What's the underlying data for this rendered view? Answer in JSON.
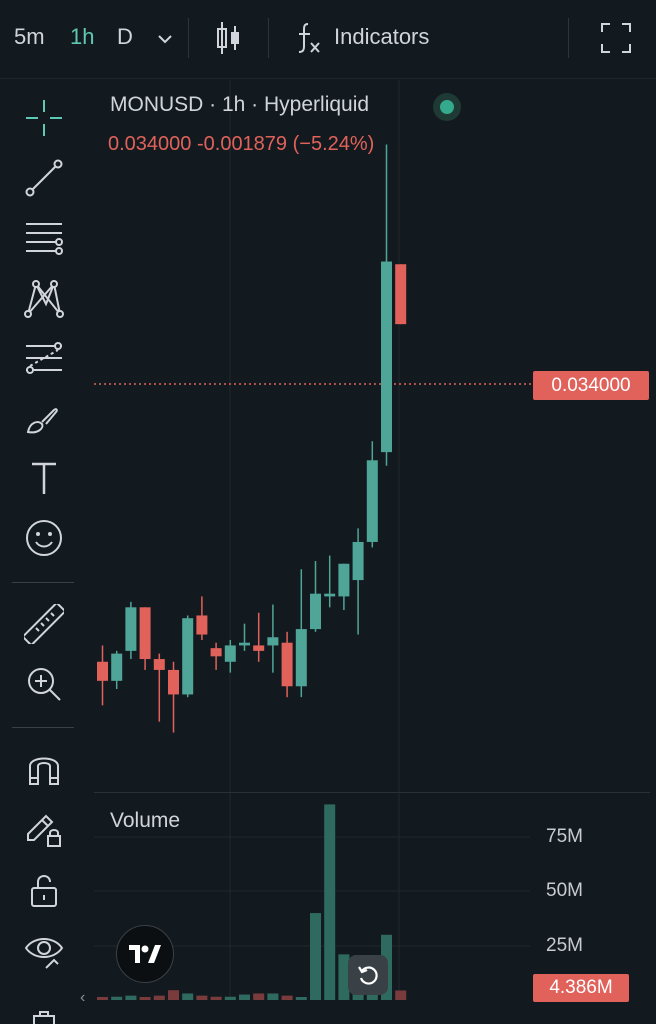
{
  "topbar": {
    "timeframes": [
      {
        "label": "5m",
        "active": false
      },
      {
        "label": "1h",
        "active": true
      },
      {
        "label": "D",
        "active": false
      }
    ],
    "indicators_label": "Indicators",
    "icons": [
      "chevron-down-icon",
      "candles-icon",
      "function-icon",
      "fullscreen-icon"
    ]
  },
  "toolbar": {
    "tools": [
      "crosshair-icon",
      "trend-line-icon",
      "horizontal-lines-icon",
      "pattern-icon",
      "fib-icon",
      "brush-icon",
      "text-icon",
      "emoji-icon",
      "ruler-icon",
      "zoom-in-icon",
      "magnet-icon",
      "lock-drawing-icon",
      "lock-icon",
      "eye-icon"
    ]
  },
  "legend": {
    "symbol": "MONUSD · 1h · Hyperliquid",
    "values": "0.034000  -0.001879 (−5.24%)",
    "price_tag": "0.034000"
  },
  "volume": {
    "label": "Volume",
    "axis": [
      "75M",
      "50M",
      "25M"
    ],
    "tag": "4.386M"
  },
  "colors": {
    "up": "#4fa698",
    "down": "#e0625a",
    "background": "#131a1f"
  },
  "chart_data": {
    "type": "candlestick",
    "title": "MONUSD · 1h · Hyperliquid",
    "candles": [
      {
        "o": 0.0216,
        "h": 0.0222,
        "l": 0.02,
        "c": 0.0209
      },
      {
        "o": 0.0209,
        "h": 0.022,
        "l": 0.0206,
        "c": 0.0219
      },
      {
        "o": 0.022,
        "h": 0.0238,
        "l": 0.0217,
        "c": 0.0236
      },
      {
        "o": 0.0236,
        "h": 0.0236,
        "l": 0.0213,
        "c": 0.0217
      },
      {
        "o": 0.0217,
        "h": 0.0219,
        "l": 0.0194,
        "c": 0.0213
      },
      {
        "o": 0.0213,
        "h": 0.0216,
        "l": 0.019,
        "c": 0.0204
      },
      {
        "o": 0.0204,
        "h": 0.0233,
        "l": 0.0203,
        "c": 0.0232
      },
      {
        "o": 0.0233,
        "h": 0.024,
        "l": 0.0224,
        "c": 0.0226
      },
      {
        "o": 0.0221,
        "h": 0.0223,
        "l": 0.0213,
        "c": 0.0218
      },
      {
        "o": 0.0216,
        "h": 0.0224,
        "l": 0.0212,
        "c": 0.0222
      },
      {
        "o": 0.0222,
        "h": 0.023,
        "l": 0.022,
        "c": 0.0223
      },
      {
        "o": 0.0222,
        "h": 0.0234,
        "l": 0.0216,
        "c": 0.022
      },
      {
        "o": 0.0222,
        "h": 0.0237,
        "l": 0.0212,
        "c": 0.0225
      },
      {
        "o": 0.0223,
        "h": 0.0227,
        "l": 0.0203,
        "c": 0.0207
      },
      {
        "o": 0.0207,
        "h": 0.025,
        "l": 0.0203,
        "c": 0.0228
      },
      {
        "o": 0.0228,
        "h": 0.0253,
        "l": 0.0227,
        "c": 0.0241
      },
      {
        "o": 0.024,
        "h": 0.0255,
        "l": 0.0236,
        "c": 0.0241
      },
      {
        "o": 0.024,
        "h": 0.0252,
        "l": 0.0235,
        "c": 0.0252
      },
      {
        "o": 0.0246,
        "h": 0.0265,
        "l": 0.0226,
        "c": 0.026
      },
      {
        "o": 0.026,
        "h": 0.0297,
        "l": 0.0258,
        "c": 0.029
      },
      {
        "o": 0.0293,
        "h": 0.0406,
        "l": 0.0288,
        "c": 0.0363
      },
      {
        "o": 0.0362,
        "h": 0.0362,
        "l": 0.034,
        "c": 0.034
      }
    ],
    "volume": [
      1,
      1.5,
      2,
      1,
      2,
      4.5,
      3,
      2,
      1.5,
      1.5,
      2.5,
      3,
      3,
      2,
      1,
      40,
      90,
      21,
      15,
      17,
      30,
      4.386
    ],
    "volume_unit": "M",
    "volume_axis": [
      25,
      50,
      75
    ],
    "last_price": 0.034,
    "change": -0.001879,
    "change_pct": -5.24,
    "price_range": [
      0.0188,
      0.0408
    ]
  }
}
